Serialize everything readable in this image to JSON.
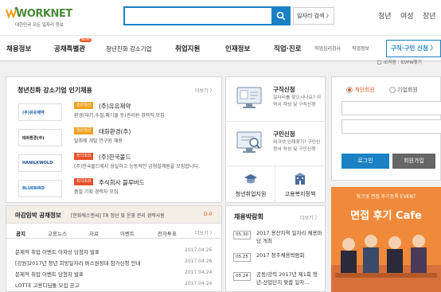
{
  "header": {
    "logo_text": "WORKNET",
    "logo_sub": "대한민국 모든 일자리 정보",
    "search_placeholder": "",
    "search_link": "일자리 검색 〉",
    "util": [
      "청년",
      "여성",
      "장년"
    ]
  },
  "nav": {
    "items": [
      "채용정보",
      "공채특별관",
      "청년친화 강소기업",
      "취업지원",
      "인재정보",
      "직업·진로"
    ],
    "new_badge": "NEW",
    "small": [
      "직업심리검사",
      "직업정보"
    ],
    "cta": "구직·구인 신청 〉"
  },
  "youth": {
    "title": "청년친화 강소기업 인기채용",
    "more": "더보기 〉",
    "jobs": [
      {
        "logo": "(주)유유제약",
        "badge": "높은임금",
        "badge_color": "#f0a020",
        "company": "(주)유유제약",
        "desc": "환경(대기,수질,폐기물 등)관리원 경력직 모집"
      },
      {
        "logo": "태화환경(주)",
        "badge": "높은임금",
        "badge_color": "#f0a020",
        "company": "태화환경(주)",
        "desc": "탈취제 개발 연구원 채용"
      },
      {
        "logo": "HANILKWOLD",
        "badge": "최다조회",
        "badge_color": "#e8502a",
        "company": "(주)한국몰드",
        "desc": "(주)한국몰드에서 성실하고 능동적인 금형설계원을 모집합니다."
      },
      {
        "logo": "BLUEBIRD",
        "badge": "최다조회",
        "badge_color": "#e8502a",
        "company": "주식회사 블루버드",
        "desc": "품질 기획 경력자 모집"
      }
    ]
  },
  "deadline": {
    "title": "마감임박 공채정보",
    "item": "[한화에스앤씨] TR 정산 및 운영 관리 경력사원",
    "dday": "D-0"
  },
  "notice": {
    "tabs": [
      "공지",
      "고용뉴스",
      "자료",
      "이벤트",
      "전자투표"
    ],
    "more": "더보기 〉",
    "items": [
      {
        "title": "문제적 취업 이벤트 아차상 당첨자 발표",
        "date": "2017.04.26"
      },
      {
        "title": "[강원]2017년 청년 희망일자리 버스원정대 참가신청 안내",
        "date": "2017.04.26"
      },
      {
        "title": "문제적 취업 이벤트 당첨자 발표",
        "date": "2017.04.24"
      },
      {
        "title": "LOTTE 고용디딤돌 모집 공고",
        "date": "2017.04.24"
      }
    ]
  },
  "apply": {
    "items": [
      {
        "title": "구직신청",
        "desc": "일자리를 찾으시나요? 이력서 작성 및 구직신청"
      },
      {
        "title": "구인신청",
        "desc": "워크넷 인재찾기! 구인신청서 작성 및 구인신청"
      }
    ],
    "links": [
      "청년취업지원",
      "고용복지정책"
    ]
  },
  "fair": {
    "title": "채용박람회",
    "more": "더보기 〉",
    "items": [
      {
        "date": "05.30",
        "name": "2017 용산지역 일자리 채용마당 개최"
      },
      {
        "date": "05.25",
        "name": "2017 청주채용박람회"
      },
      {
        "date": "05.24",
        "name": "공동/강력 2017년 제1회 청년-산업단지 맞춤 일자..."
      }
    ]
  },
  "login": {
    "personal": "개인회원",
    "company": "기업회원",
    "save_id": "ID저장 : ID/PW찾기",
    "login_btn": "로그인",
    "join_btn": "회원가입"
  },
  "ad": {
    "top": "워크넷 면접 후기등록 EVENT",
    "big": "면접 후기 Cafe"
  },
  "colors": {
    "primary": "#1a82c4",
    "accent": "#f05a28",
    "logo_green": "#4a8a3a",
    "ad_orange": "#f08a3a"
  }
}
